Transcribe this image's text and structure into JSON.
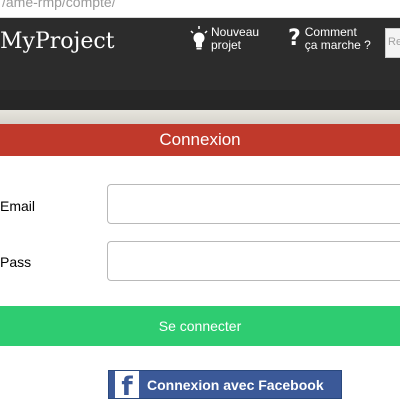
{
  "browser": {
    "url_fragment": "/ame-rmp/compte/"
  },
  "header": {
    "logo": "MyProject",
    "nav": {
      "new_project": {
        "line1": "Nouveau",
        "line2": "projet",
        "icon": "lightbulb-icon"
      },
      "how_it_works": {
        "line1": "Comment",
        "line2": "ça marche ?",
        "icon": "question-mark-icon"
      }
    },
    "search": {
      "placeholder": "Re"
    }
  },
  "login": {
    "title": "Connexion",
    "email_label": "Email",
    "pass_label": "Pass",
    "email_value": "",
    "pass_value": "",
    "submit_label": "Se connecter",
    "facebook_label": "Connexion avec Facebook",
    "facebook_icon": "facebook-icon"
  },
  "colors": {
    "header_bg": "#2c2c2c",
    "title_bar": "#c0392b",
    "submit": "#2ecc71",
    "facebook": "#3b5998"
  }
}
